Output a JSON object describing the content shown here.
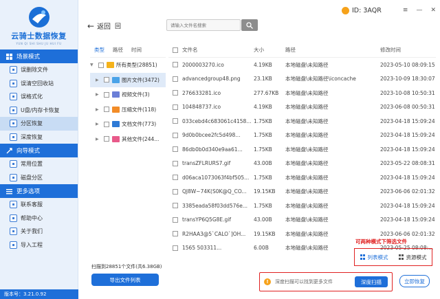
{
  "sidebar": {
    "brand": "云骑士数据恢复",
    "brand_sub": "YUN QI SHI SHU JU HUI FU",
    "sections": [
      {
        "label": "场景模式",
        "items": [
          {
            "label": "误删除文件"
          },
          {
            "label": "误清空回收站"
          },
          {
            "label": "误格式化"
          },
          {
            "label": "U盘/内存卡恢复"
          },
          {
            "label": "分区恢复"
          },
          {
            "label": "深度恢复"
          }
        ]
      },
      {
        "label": "向导模式",
        "items": [
          {
            "label": "常用位置"
          },
          {
            "label": "磁盘分区"
          }
        ]
      },
      {
        "label": "更多选项",
        "items": [
          {
            "label": "联系客服"
          },
          {
            "label": "帮助中心"
          },
          {
            "label": "关于我们"
          },
          {
            "label": "导入工程"
          }
        ]
      }
    ],
    "active_item": "分区恢复",
    "version": "版本号：3.21.0.92"
  },
  "header": {
    "back_label": "返回",
    "home_label": "回",
    "search_placeholder": "请输入文件名搜索",
    "id_label": "ID: 3AQR"
  },
  "tree": {
    "tabs": [
      "类型",
      "路径",
      "时间"
    ],
    "nodes": [
      {
        "label": "所有类型(28851)",
        "color": "#f5b21a"
      },
      {
        "label": "图片文件(3472)",
        "color": "#4aa3e8"
      },
      {
        "label": "视频文件(3)",
        "color": "#6b7fd7"
      },
      {
        "label": "压缩文件(118)",
        "color": "#f28c28"
      },
      {
        "label": "文档文件(773)",
        "color": "#2e7ad6"
      },
      {
        "label": "其他文件(244...",
        "color": "#e85a8a"
      }
    ]
  },
  "table": {
    "headers": [
      "文件名",
      "大小",
      "路径",
      "修改时间"
    ],
    "rows": [
      {
        "name": "2000003270.ico",
        "size": "4.19KB",
        "path": "本地磁盘\\未知路径",
        "time": "2023-05-10 08:09:15"
      },
      {
        "name": "advancedgroup48.png",
        "size": "23.1KB",
        "path": "本地磁盘\\未知路径\\iconcache",
        "time": "2023-10-09 18:30:07"
      },
      {
        "name": "276633281.ico",
        "size": "277.67KB",
        "path": "本地磁盘\\未知路径",
        "time": "2023-10-08 10:50:31"
      },
      {
        "name": "104848737.ico",
        "size": "4.19KB",
        "path": "本地磁盘\\未知路径",
        "time": "2023-06-08 00:50:31"
      },
      {
        "name": "033cebd4c683061c4158...",
        "size": "1.75KB",
        "path": "本地磁盘\\未知路径",
        "time": "2023-04-18 15:09:24"
      },
      {
        "name": "9d0b0bcee2fc5d498...",
        "size": "1.75KB",
        "path": "本地磁盘\\未知路径",
        "time": "2023-04-18 15:09:24"
      },
      {
        "name": "86db0b0d340e9aa61...",
        "size": "1.75KB",
        "path": "本地磁盘\\未知路径",
        "time": "2023-04-18 15:09:24"
      },
      {
        "name": "transZFLRURS7.gif",
        "size": "43.00B",
        "path": "本地磁盘\\未知路径",
        "time": "2023-05-22 08:08:31"
      },
      {
        "name": "d06aca1073063f4bf505...",
        "size": "1.75KB",
        "path": "本地磁盘\\未知路径",
        "time": "2023-04-18 15:09:24"
      },
      {
        "name": "QJ8W~74K(S0K@Q_CO...",
        "size": "19.15KB",
        "path": "本地磁盘\\未知路径",
        "time": "2023-06-06 02:01:32"
      },
      {
        "name": "3385eada58f03dd576e...",
        "size": "1.75KB",
        "path": "本地磁盘\\未知路径",
        "time": "2023-04-18 15:09:24"
      },
      {
        "name": "transYP6Q5G8E.gif",
        "size": "43.00B",
        "path": "本地磁盘\\未知路径",
        "time": "2023-04-18 15:09:24"
      },
      {
        "name": "R2HAA3@5`CALO`]OH...",
        "size": "19.15KB",
        "path": "本地磁盘\\未知路径",
        "time": "2023-06-06 02:01:32"
      },
      {
        "name": "1565 503311...",
        "size": "6.00B",
        "path": "本地磁盘\\未知路径",
        "time": "2023-05-25 08:08:..."
      }
    ]
  },
  "footer": {
    "stat_text": "扫描到28851个文件(共6.38GB)",
    "export_label": "导出文件列表",
    "hint_label": "可两种模式下筛选文件",
    "list_mode_label": "列表模式",
    "thumb_mode_label": "资源模式",
    "deep_hint": "深度扫描可以找到更多文件",
    "deep_button": "深度扫描",
    "recover_button": "立即恢复"
  }
}
